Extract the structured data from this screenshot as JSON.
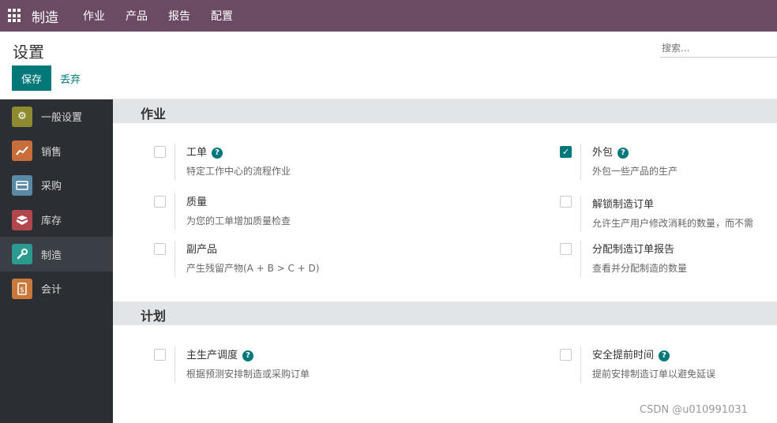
{
  "navbar": {
    "app_name": "制造",
    "menus": [
      "作业",
      "产品",
      "报告",
      "配置"
    ]
  },
  "control_panel": {
    "breadcrumb": "设置",
    "search_placeholder": "搜索...",
    "save_label": "保存",
    "discard_label": "丢弃"
  },
  "sidebar": {
    "items": [
      {
        "label": "一般设置",
        "icon": "gear-icon",
        "color": "#8d8a2f"
      },
      {
        "label": "销售",
        "icon": "chart-icon",
        "color": "#c86d3c"
      },
      {
        "label": "采购",
        "icon": "credit-card-icon",
        "color": "#5a89a3"
      },
      {
        "label": "库存",
        "icon": "box-icon",
        "color": "#b1464c"
      },
      {
        "label": "制造",
        "icon": "wrench-icon",
        "color": "#2c9a91",
        "active": true
      },
      {
        "label": "会计",
        "icon": "invoice-icon",
        "color": "#c8793b"
      }
    ]
  },
  "sections": [
    {
      "title": "作业",
      "settings": [
        {
          "title": "工单",
          "help": true,
          "desc": "特定工作中心的流程作业",
          "checked": false
        },
        {
          "title": "外包",
          "help": true,
          "desc": "外包一些产品的生产",
          "checked": true
        },
        {
          "title": "质量",
          "help": false,
          "desc": "为您的工单增加质量检查",
          "checked": false
        },
        {
          "title": "解锁制造订单",
          "help": false,
          "desc": "允许生产用户修改消耗的数量，而不需",
          "checked": false
        },
        {
          "title": "副产品",
          "help": false,
          "desc": "产生残留产物(A + B > C + D)",
          "checked": false
        },
        {
          "title": "分配制造订单报告",
          "help": false,
          "desc": "查看并分配制造的数量",
          "checked": false
        }
      ]
    },
    {
      "title": "计划",
      "settings": [
        {
          "title": "主生产调度",
          "help": true,
          "desc": "根据预测安排制造或采购订单",
          "checked": false
        },
        {
          "title": "安全提前时间",
          "help": true,
          "desc": "提前安排制造订单以避免延误",
          "checked": false
        }
      ]
    }
  ],
  "watermark": "CSDN @u010991031",
  "colors": {
    "navbar": "#6b4a63",
    "accent": "#00787a",
    "sidebar": "#2b2f33"
  }
}
